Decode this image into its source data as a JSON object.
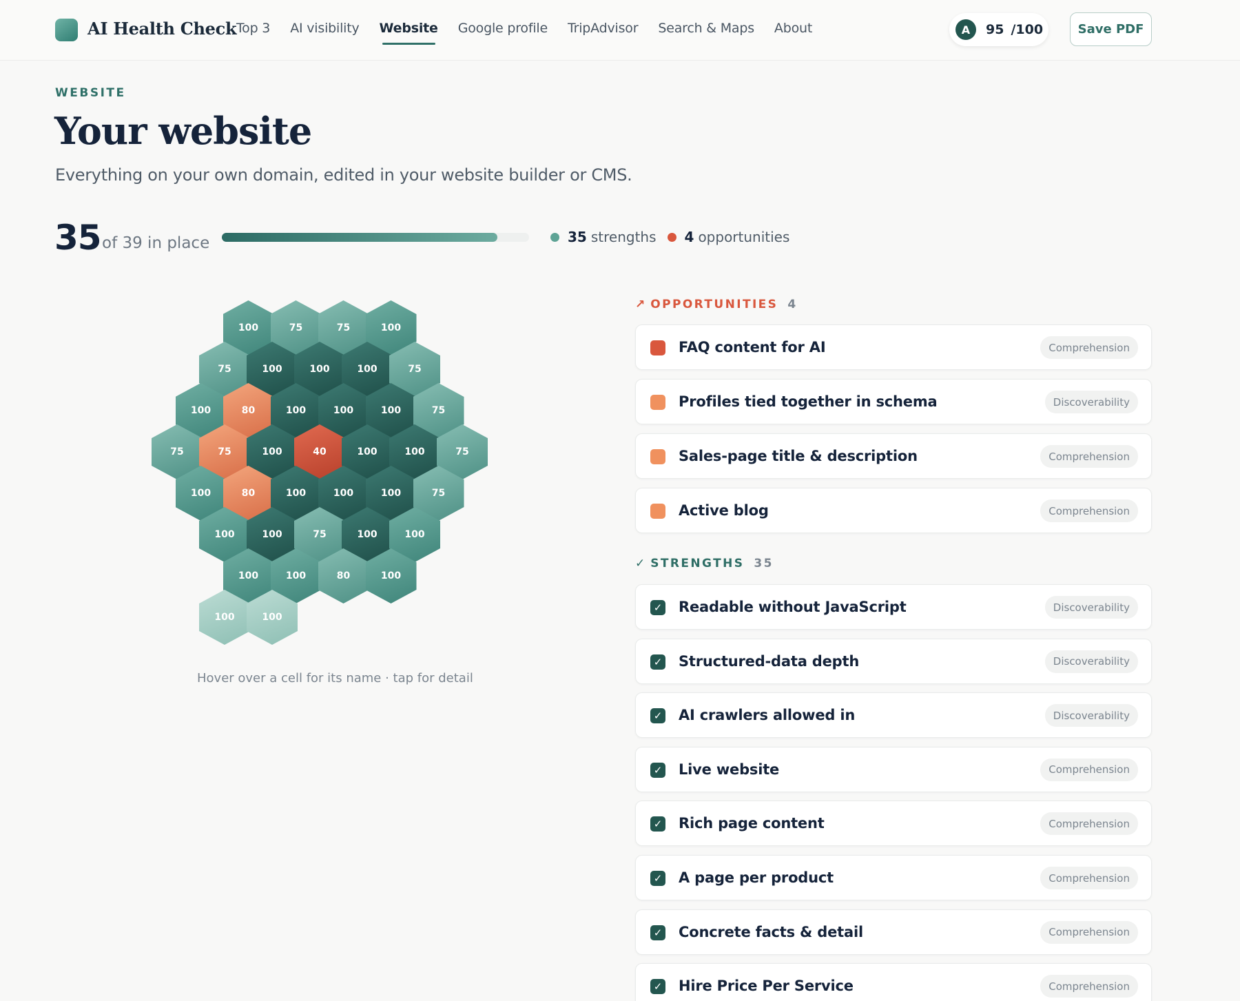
{
  "nav": {
    "brand": "AI Health Check",
    "links": [
      "Top 3",
      "AI visibility",
      "Website",
      "Google profile",
      "TripAdvisor",
      "Search & Maps",
      "About"
    ],
    "active": "Website",
    "score_avatar": "A",
    "score_value": "95",
    "score_max": "/100",
    "save_label": "Save PDF"
  },
  "header": {
    "eyebrow": "WEBSITE",
    "title": "Your website",
    "subtitle": "Everything on your own domain, edited in your website builder or CMS."
  },
  "summary": {
    "in_place": "35",
    "in_place_sub": "of 39 in place",
    "progress_fraction": 0.897,
    "strengths_count": "35",
    "strengths_label": "strengths",
    "opportunities_count": "4",
    "opportunities_label": "opportunities",
    "strength_color": "#5ea395",
    "opportunity_color": "#d9573d"
  },
  "hexgrid": {
    "rows": [
      {
        "offset": 3,
        "cells": [
          100,
          75,
          75,
          100
        ]
      },
      {
        "offset": 2,
        "cells": [
          75,
          100,
          100,
          100,
          75
        ]
      },
      {
        "offset": 1,
        "cells": [
          100,
          80,
          100,
          100,
          100,
          75
        ]
      },
      {
        "offset": 0,
        "cells": [
          75,
          75,
          100,
          40,
          100,
          100,
          75
        ]
      },
      {
        "offset": 1,
        "cells": [
          100,
          80,
          100,
          100,
          100,
          75
        ]
      },
      {
        "offset": 2,
        "cells": [
          100,
          100,
          75,
          100,
          100
        ]
      },
      {
        "offset": 3,
        "cells": [
          100,
          100,
          80,
          100
        ]
      },
      {
        "offset": 2,
        "cells": [
          100,
          100
        ]
      }
    ],
    "hint": "Hover over a cell for its name · tap for detail"
  },
  "opportunities": {
    "heading": "OPPORTUNITIES",
    "count": "4",
    "items": [
      {
        "label": "FAQ content for AI",
        "tag": "Comprehension",
        "color": "#d9573d"
      },
      {
        "label": "Profiles tied together in schema",
        "tag": "Discoverability",
        "color": "#f0915e"
      },
      {
        "label": "Sales-page title & description",
        "tag": "Comprehension",
        "color": "#f0915e"
      },
      {
        "label": "Active blog",
        "tag": "Comprehension",
        "color": "#f0915e"
      }
    ]
  },
  "strengths": {
    "heading": "STRENGTHS",
    "count": "35",
    "items": [
      {
        "label": "Readable without JavaScript",
        "tag": "Discoverability"
      },
      {
        "label": "Structured-data depth",
        "tag": "Discoverability"
      },
      {
        "label": "AI crawlers allowed in",
        "tag": "Discoverability"
      },
      {
        "label": "Live website",
        "tag": "Comprehension"
      },
      {
        "label": "Rich page content",
        "tag": "Comprehension"
      },
      {
        "label": "A page per product",
        "tag": "Comprehension"
      },
      {
        "label": "Concrete facts & detail",
        "tag": "Comprehension"
      },
      {
        "label": "Hire Price Per Service",
        "tag": "Comprehension"
      }
    ]
  }
}
